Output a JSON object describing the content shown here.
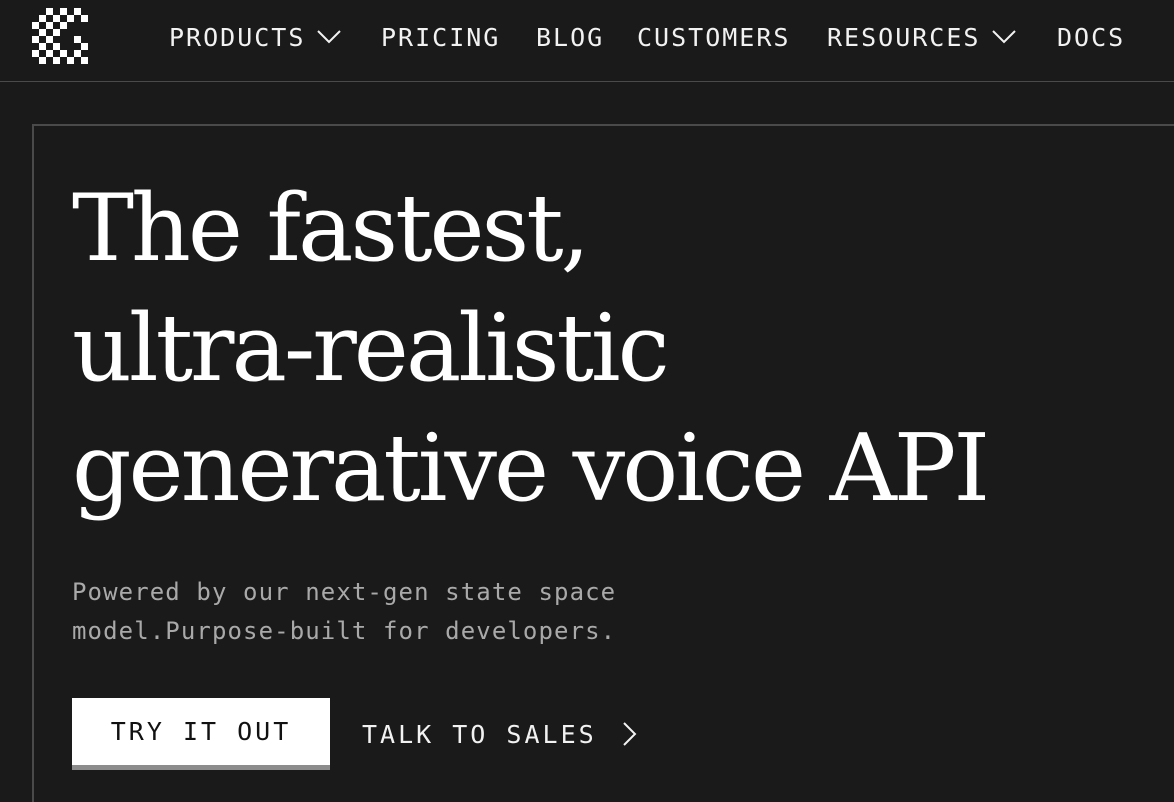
{
  "header": {
    "logo_icon": "pixel-checker-logo-icon",
    "nav": [
      {
        "label": "PRODUCTS",
        "has_dropdown": true
      },
      {
        "label": "PRICING",
        "has_dropdown": false
      },
      {
        "label": "BLOG",
        "has_dropdown": false
      },
      {
        "label": "CUSTOMERS",
        "has_dropdown": false
      },
      {
        "label": "RESOURCES",
        "has_dropdown": true
      },
      {
        "label": "DOCS",
        "has_dropdown": false
      }
    ]
  },
  "hero": {
    "headline_lines": [
      "The fastest,",
      "ultra-realistic",
      "generative voice API"
    ],
    "subtitle_lines": [
      "Powered by our next-gen state space",
      "model.Purpose-built for developers."
    ],
    "primary_cta": "TRY IT OUT",
    "secondary_cta": "TALK TO SALES",
    "secondary_cta_icon": "chevron-right-icon"
  },
  "colors": {
    "background": "#1a1a1a",
    "text": "#f2f2f2",
    "muted_text": "#a9a9a9",
    "border": "#4a4a4a",
    "button_bg": "#ffffff",
    "button_shadow": "#8c8c8c"
  }
}
